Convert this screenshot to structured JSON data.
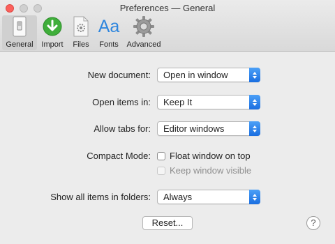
{
  "window": {
    "title": "Preferences — General"
  },
  "toolbar": {
    "general": "General",
    "import": "Import",
    "files": "Files",
    "fonts": "Fonts",
    "fonts_icon_text": "Aa",
    "advanced": "Advanced"
  },
  "form": {
    "new_document": {
      "label": "New document:",
      "value": "Open in window"
    },
    "open_items_in": {
      "label": "Open items in:",
      "value": "Keep It"
    },
    "allow_tabs_for": {
      "label": "Allow tabs for:",
      "value": "Editor windows"
    },
    "compact_mode": {
      "label": "Compact Mode:",
      "float_window": {
        "label": "Float window on top",
        "checked": false
      },
      "keep_visible": {
        "label": "Keep window visible",
        "checked": false,
        "enabled": false
      }
    },
    "show_all_items": {
      "label": "Show all items in folders:",
      "value": "Always"
    }
  },
  "buttons": {
    "reset": "Reset...",
    "help": "?"
  },
  "colors": {
    "accent": "#1a6ee0",
    "close": "#fc605c",
    "import_green": "#3fae3a",
    "fonts_blue": "#2e86de"
  }
}
